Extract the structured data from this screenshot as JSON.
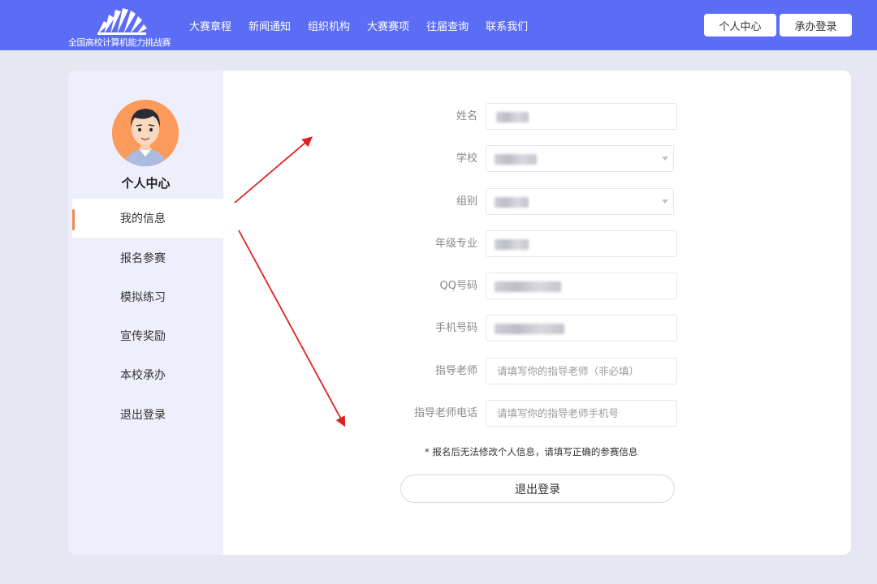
{
  "header": {
    "logo_text": "全国高校计算机能力挑战赛",
    "nav": [
      "大赛章程",
      "新闻通知",
      "组织机构",
      "大赛赛项",
      "往届查询",
      "联系我们"
    ],
    "personal_center": "个人中心",
    "host_login": "承办登录",
    "colors": {
      "bar": "#5b6cf5"
    }
  },
  "sidebar": {
    "title": "个人中心",
    "items": [
      {
        "label": "我的信息",
        "active": true
      },
      {
        "label": "报名参赛",
        "active": false
      },
      {
        "label": "模拟练习",
        "active": false
      },
      {
        "label": "宣传奖励",
        "active": false
      },
      {
        "label": "本校承办",
        "active": false
      },
      {
        "label": "退出登录",
        "active": false
      }
    ],
    "colors": {
      "active_marker": "#f08a4b",
      "avatar_bg": "#fb9a5b"
    }
  },
  "form": {
    "fields": [
      {
        "label": "姓名",
        "value": "",
        "placeholder": "",
        "blurred": true
      },
      {
        "label": "学校",
        "value": "",
        "placeholder": "",
        "blurred": true,
        "select": true
      },
      {
        "label": "组别",
        "value": "",
        "placeholder": "",
        "blurred": true,
        "select": true
      },
      {
        "label": "年级专业",
        "value": "",
        "placeholder": "",
        "blurred": true
      },
      {
        "label": "QQ号码",
        "value": "",
        "placeholder": "",
        "blurred": true
      },
      {
        "label": "手机号码",
        "value": "",
        "placeholder": "",
        "blurred": true
      },
      {
        "label": "指导老师",
        "value": "",
        "placeholder": "请填写你的指导老师（非必填）"
      },
      {
        "label": "指导老师电话",
        "value": "",
        "placeholder": "请填写你的指导老师手机号"
      }
    ],
    "note": "* 报名后无法修改个人信息，请填写正确的参赛信息",
    "logout_button": "退出登录"
  },
  "annotation_colors": {
    "arrow": "#e02020"
  }
}
